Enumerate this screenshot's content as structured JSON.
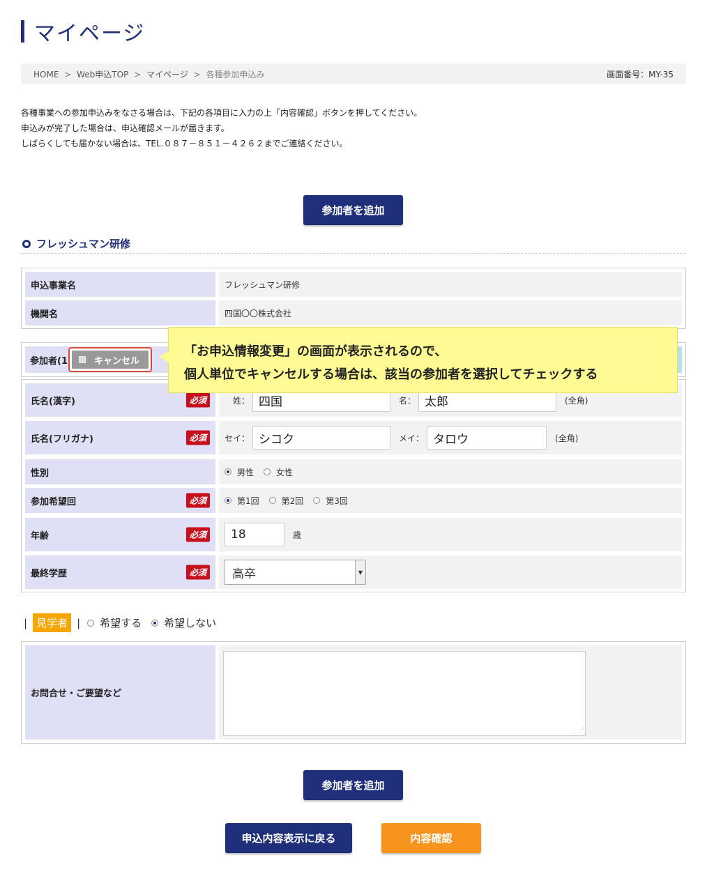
{
  "page": {
    "title": "マイページ"
  },
  "breadcrumb": {
    "items": [
      "HOME",
      "Web申込TOP",
      "マイページ"
    ],
    "separator": ">",
    "current": "各種参加申込み",
    "screen_number": "画面番号：MY-35"
  },
  "intro": {
    "lines": [
      "各種事業への参加申込みをなさる場合は、下記の各項目に入力の上「内容確認」ボタンを押してください。",
      "申込みが完了した場合は、申込確認メールが届きます。",
      "しばらくしても届かない場合は、TEL.０８７－８５１－４２６２までご連絡ください。"
    ]
  },
  "buttons": {
    "add_participant": "参加者を追加",
    "back": "申込内容表示に戻る",
    "confirm": "内容確認"
  },
  "section": {
    "title": "フレッシュマン研修"
  },
  "event_info": {
    "rows": [
      {
        "label": "申込事業名",
        "value": "フレッシュマン研修"
      },
      {
        "label": "機関名",
        "value": "四国〇〇株式会社"
      }
    ]
  },
  "participant": {
    "header_label": "参加者(1)",
    "cancel_label": "キャンセル",
    "required_badge": "必須",
    "name_kanji": {
      "label": "氏名(漢字)",
      "sei_label": "姓：",
      "sei_value": "四国",
      "mei_label": "名：",
      "mei_value": "太郎",
      "note": "(全角)"
    },
    "name_kana": {
      "label": "氏名(フリガナ)",
      "sei_label": "セイ：",
      "sei_value": "シコク",
      "mei_label": "メイ：",
      "mei_value": "タロウ",
      "note": "(全角)"
    },
    "gender": {
      "label": "性別",
      "options": [
        "男性",
        "女性"
      ],
      "selected": "男性"
    },
    "session": {
      "label": "参加希望回",
      "options": [
        "第1回",
        "第2回",
        "第3回"
      ],
      "selected": "第1回"
    },
    "age": {
      "label": "年齢",
      "value": "18",
      "unit": "歳"
    },
    "education": {
      "label": "最終学歴",
      "selected": "高卒"
    }
  },
  "callout": {
    "line1": "「お申込情報変更」の画面が表示されるので、",
    "line2": "個人単位でキャンセルする場合は、該当の参加者を選択してチェックする"
  },
  "visitor": {
    "tag": "見学者",
    "options": [
      "希望する",
      "希望しない"
    ],
    "selected": "希望しない"
  },
  "inquiry": {
    "label": "お問合せ・ご要望など",
    "value": ""
  },
  "colors": {
    "navy": "#1f2f7a",
    "orange": "#f7941d",
    "required": "#c8101d",
    "label_bg": "#dfdff5",
    "callout_bg": "#fffb94"
  }
}
